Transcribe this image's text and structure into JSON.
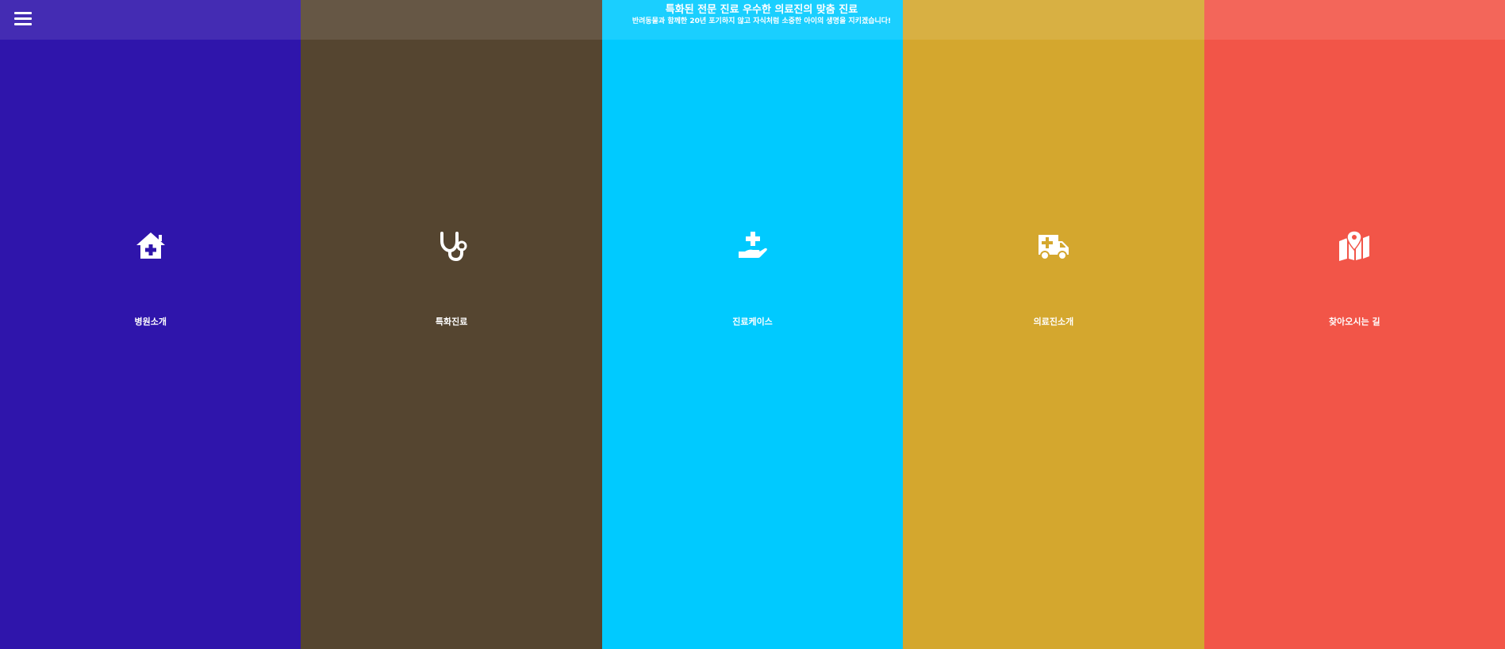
{
  "header": {
    "menu_icon": "hamburger-menu-icon",
    "title": "특화된 전문 진료 우수한 의료진의 맞춤 진료",
    "subtitle": "반려동물과 함께한 20년 포기하지 않고 자식처럼 소중한 아이의 생명을 지키겠습니다!"
  },
  "sections": [
    {
      "label": "병원소개",
      "icon": "clinic-house-icon",
      "color": "#2F15AB"
    },
    {
      "label": "특화진료",
      "icon": "stethoscope-icon",
      "color": "#554530"
    },
    {
      "label": "진료케이스",
      "icon": "hand-medical-icon",
      "color": "#00CAFF"
    },
    {
      "label": "의료진소개",
      "icon": "ambulance-icon",
      "color": "#D4A72E"
    },
    {
      "label": "찾아오시는 길",
      "icon": "map-location-icon",
      "color": "#F25548"
    }
  ]
}
